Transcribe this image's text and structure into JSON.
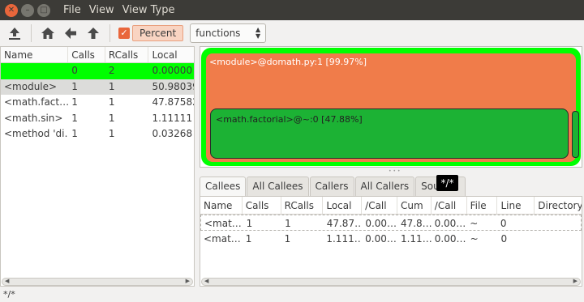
{
  "window": {
    "menu": [
      "File",
      "View",
      "View Type"
    ]
  },
  "toolbar": {
    "percent_label": "Percent",
    "percent_checked": true,
    "view_type": "functions",
    "icons": [
      "upload-icon",
      "home-icon",
      "back-arrow-icon",
      "up-arrow-icon"
    ]
  },
  "left_table": {
    "headers": [
      "Name",
      "Calls",
      "RCalls",
      "Local"
    ],
    "rows": [
      {
        "name": "",
        "calls": "0",
        "rcalls": "2",
        "local": "0.00000"
      },
      {
        "name": "<module>",
        "calls": "1",
        "rcalls": "1",
        "local": "50.98039"
      },
      {
        "name": "<math.fact…",
        "calls": "1",
        "rcalls": "1",
        "local": "47.87582"
      },
      {
        "name": "<math.sin>",
        "calls": "1",
        "rcalls": "1",
        "local": "1.11111"
      },
      {
        "name": "<method 'di…",
        "calls": "1",
        "rcalls": "1",
        "local": "0.03268"
      }
    ]
  },
  "flame": {
    "module_label": "<module>@domath.py:1 [99.97%]",
    "factorial_label": "<math.factorial>@~:0 [47.88%]",
    "colors": {
      "root": "#00ff00",
      "module": "#f07c4a",
      "factorial": "#1cb234"
    }
  },
  "tabs": {
    "items": [
      "Callees",
      "All Callees",
      "Callers",
      "All Callers",
      "Sour"
    ],
    "tooltip": "*/*"
  },
  "bottom_table": {
    "headers": [
      "Name",
      "Calls",
      "RCalls",
      "Local",
      "/Call",
      "Cum",
      "/Call",
      "File",
      "Line",
      "Directory"
    ],
    "rows": [
      [
        "<mat…",
        "1",
        "1",
        "47.87…",
        "0.00…",
        "47.8…",
        "0.00…",
        "~",
        "0",
        ""
      ],
      [
        "<mat…",
        "1",
        "1",
        "1.111…",
        "0.00…",
        "1.11…",
        "0.00…",
        "~",
        "0",
        ""
      ]
    ]
  },
  "status": "*/*"
}
